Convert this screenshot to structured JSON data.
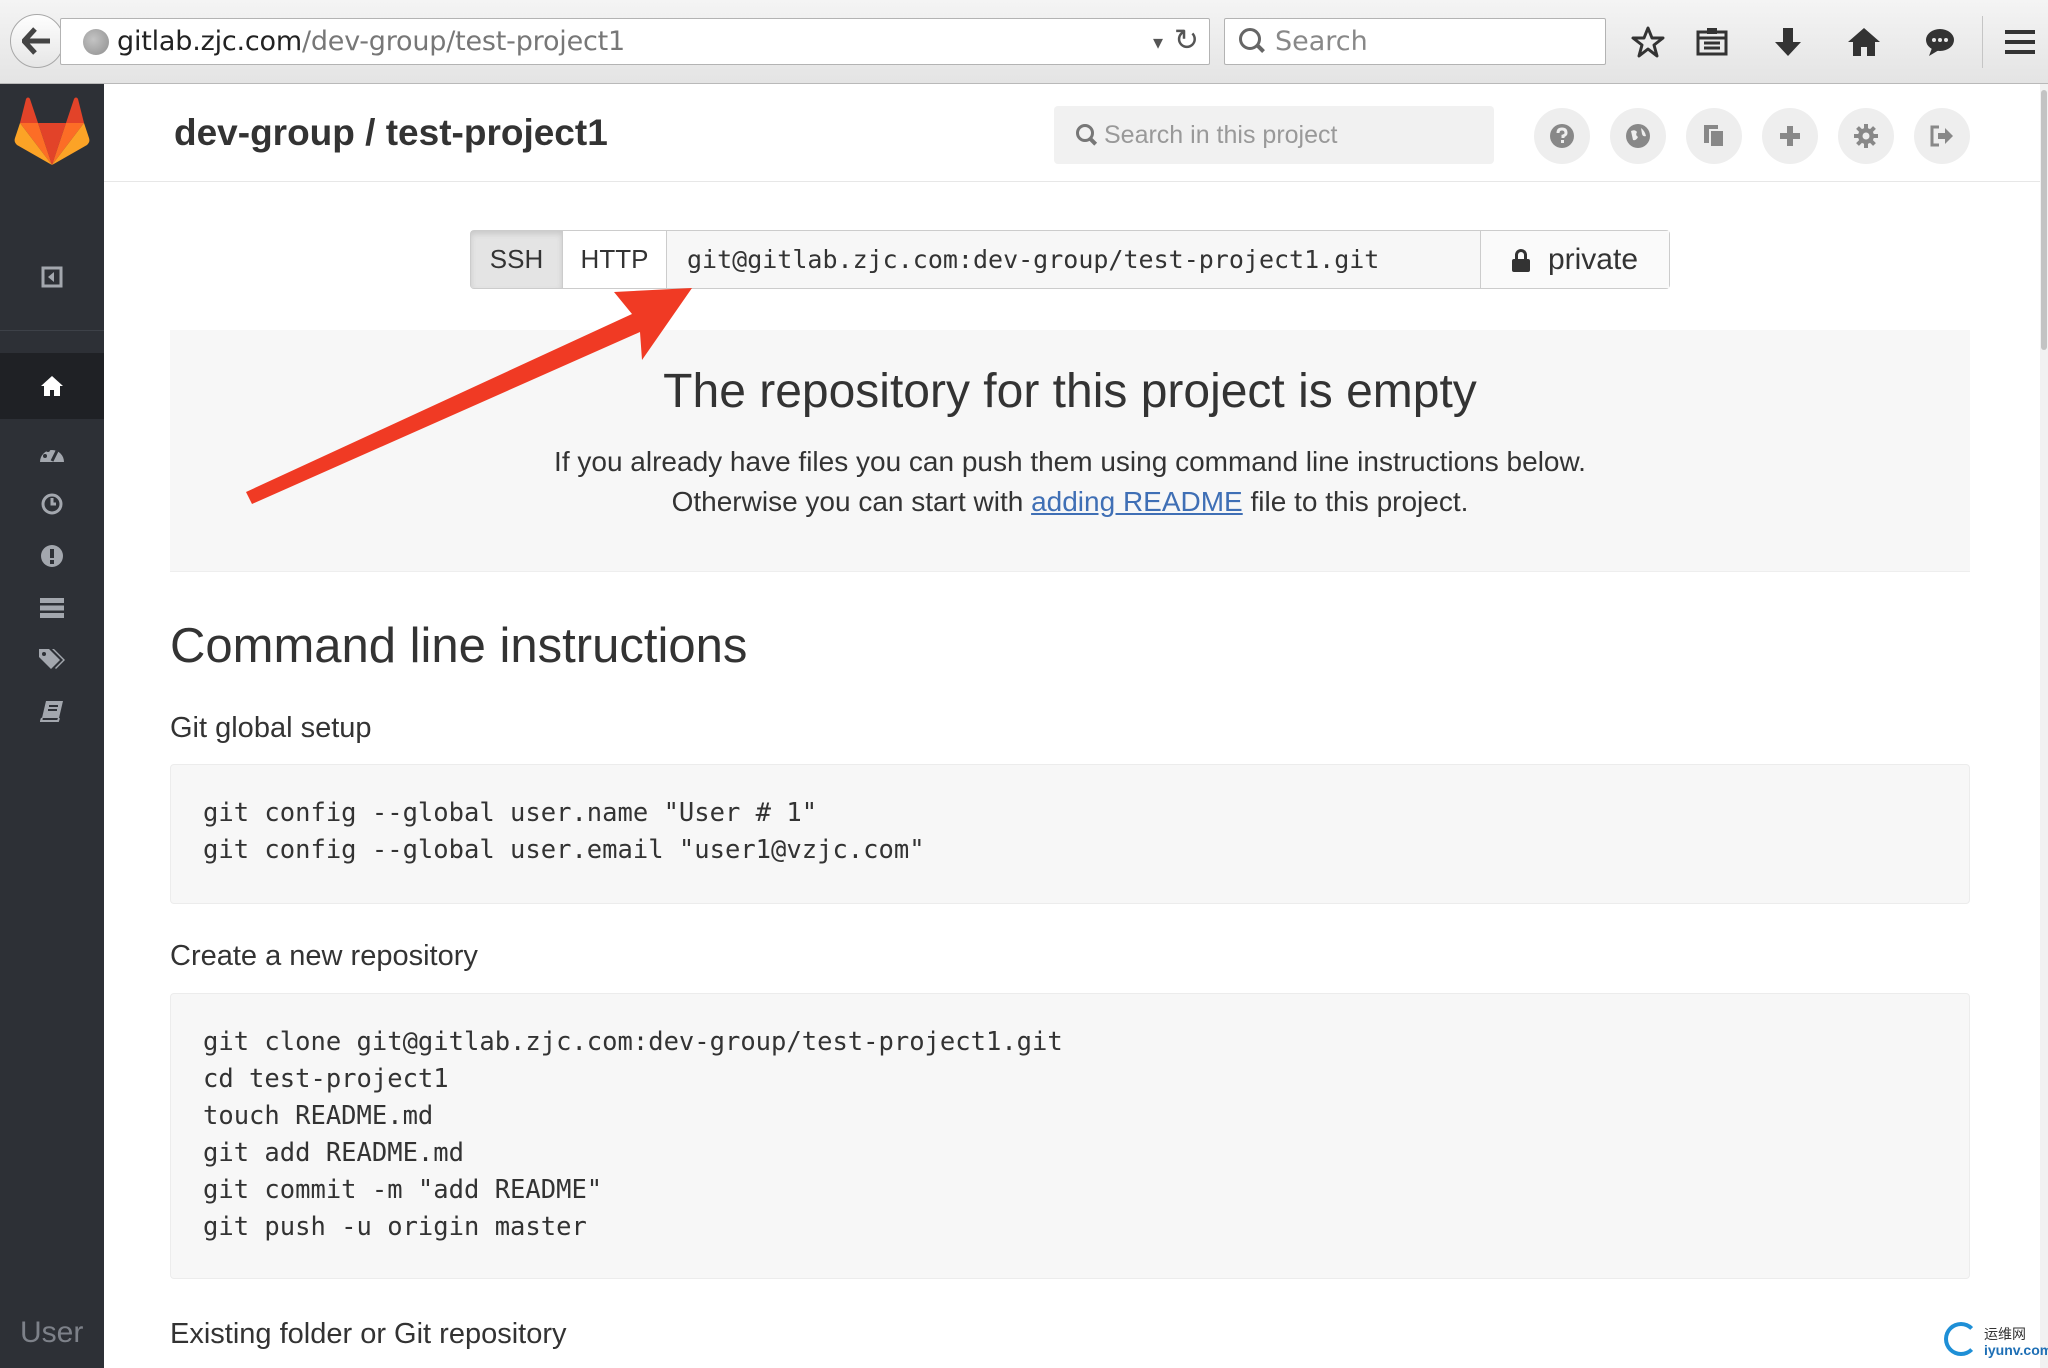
{
  "browser": {
    "url_domain": "gitlab.zjc.com",
    "url_path": "/dev-group/test-project1",
    "search_placeholder": "Search"
  },
  "sidebar": {
    "user_label": "User"
  },
  "header": {
    "project_title": "dev-group / test-project1",
    "search_placeholder": "Search in this project"
  },
  "clone": {
    "ssh_label": "SSH",
    "http_label": "HTTP",
    "url": "git@gitlab.zjc.com:dev-group/test-project1.git",
    "visibility": "private"
  },
  "empty_state": {
    "title": "The repository for this project is empty",
    "line1": "If you already have files you can push them using command line instructions below.",
    "line2_before": "Otherwise you can start with ",
    "line2_link": "adding README",
    "line2_after": " file to this project."
  },
  "instructions": {
    "title": "Command line instructions",
    "git_setup_heading": "Git global setup",
    "git_setup_code": "git config --global user.name \"User # 1\"\ngit config --global user.email \"user1@vzjc.com\"",
    "new_repo_heading": "Create a new repository",
    "new_repo_code": "git clone git@gitlab.zjc.com:dev-group/test-project1.git\ncd test-project1\ntouch README.md\ngit add README.md\ngit commit -m \"add README\"\ngit push -u origin master",
    "existing_heading": "Existing folder or Git repository"
  },
  "watermark": {
    "cn": "运维网",
    "en": "iyunv.com"
  },
  "colors": {
    "sidebar_bg": "#2d3036",
    "link": "#3f6fb5",
    "annotation_arrow": "#f03a24",
    "gitlab_orange": "#e24329"
  }
}
